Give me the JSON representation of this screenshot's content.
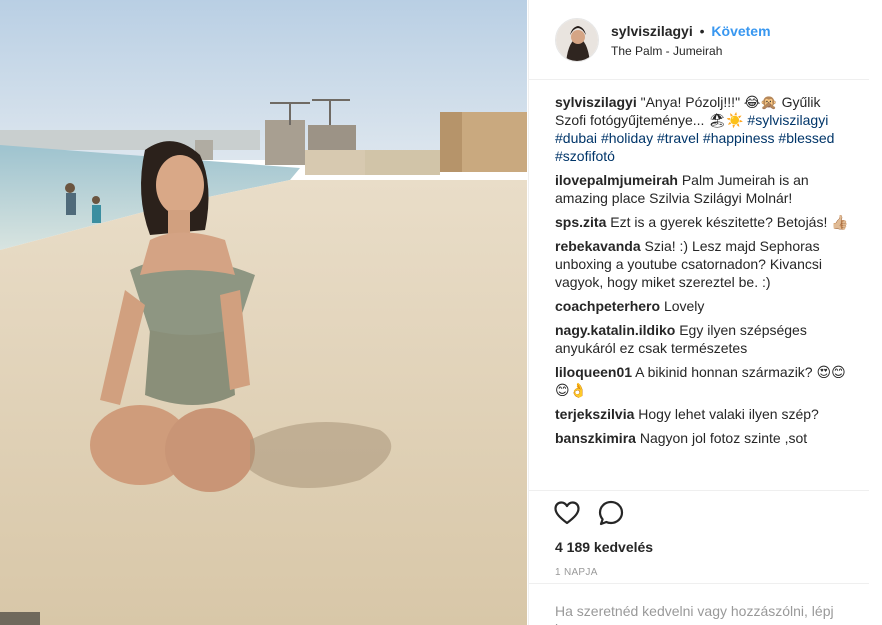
{
  "header": {
    "username": "sylviszilagyi",
    "separator": "•",
    "follow_label": "Követem",
    "location": "The Palm - Jumeirah"
  },
  "caption": {
    "user": "sylviszilagyi",
    "text": "\"Anya! Pózolj!!!\" 😂🙊 Gyűlik Szofi fotógyűjteménye... 🏖☀️",
    "tags": [
      "#sylviszilagyi",
      "#dubai",
      "#holiday",
      "#travel",
      "#happiness",
      "#blessed",
      "#szofifotó"
    ]
  },
  "comments": [
    {
      "user": "ilovepalmjumeirah",
      "text": "Palm Jumeirah is an amazing place Szilvia Szilágyi Molnár!"
    },
    {
      "user": "sps.zita",
      "text": "Ezt is a gyerek készitette? Betojás! 👍🏼"
    },
    {
      "user": "rebekavanda",
      "text": "Szia! :) Lesz majd Sephoras unboxing a youtube csatornadon? Kivancsi vagyok, hogy miket szereztel be. :)"
    },
    {
      "user": "coachpeterhero",
      "text": "Lovely"
    },
    {
      "user": "nagy.katalin.ildiko",
      "text": "Egy ilyen szépséges anyukáról ez csak természetes"
    },
    {
      "user": "liloqueen01",
      "text": "A bikinid honnan származik? 😍😊😊👌"
    },
    {
      "user": "terjekszilvia",
      "text": "Hogy lehet valaki ilyen szép?"
    },
    {
      "user": "banszkimira",
      "text": "Nagyon jol fotoz szinte ,sot"
    }
  ],
  "actions": {
    "like_icon": "heart-outline-icon",
    "comment_icon": "speech-bubble-icon",
    "likes_text": "4 189 kedvelés",
    "time_text": "1 NAPJA"
  },
  "login_prompt": "Ha szeretnéd kedvelni vagy hozzászólni, lépj be."
}
